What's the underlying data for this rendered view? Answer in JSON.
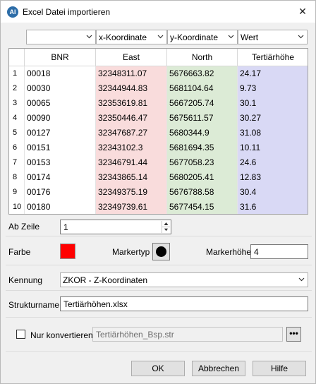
{
  "window": {
    "title": "Excel Datei importieren",
    "close_glyph": "✕",
    "icon_text": "AI"
  },
  "column_mapping": [
    "",
    "x-Koordinate",
    "y-Koordinate",
    "Wert"
  ],
  "table": {
    "headers": [
      "BNR",
      "East",
      "North",
      "Tertiärhöhe"
    ],
    "rows": [
      {
        "n": "1",
        "bnr": "00018",
        "east": "32348311.07",
        "north": "5676663.82",
        "tert": "24.17"
      },
      {
        "n": "2",
        "bnr": "00030",
        "east": "32344944.83",
        "north": "5681104.64",
        "tert": "9.73"
      },
      {
        "n": "3",
        "bnr": "00065",
        "east": "32353619.81",
        "north": "5667205.74",
        "tert": "30.1"
      },
      {
        "n": "4",
        "bnr": "00090",
        "east": "32350446.47",
        "north": "5675611.57",
        "tert": "30.27"
      },
      {
        "n": "5",
        "bnr": "00127",
        "east": "32347687.27",
        "north": "5680344.9",
        "tert": "31.08"
      },
      {
        "n": "6",
        "bnr": "00151",
        "east": "32343102.3",
        "north": "5681694.35",
        "tert": "10.11"
      },
      {
        "n": "7",
        "bnr": "00153",
        "east": "32346791.44",
        "north": "5677058.23",
        "tert": "24.6"
      },
      {
        "n": "8",
        "bnr": "00174",
        "east": "32343865.14",
        "north": "5680205.41",
        "tert": "12.83"
      },
      {
        "n": "9",
        "bnr": "00176",
        "east": "32349375.19",
        "north": "5676788.58",
        "tert": "30.4"
      },
      {
        "n": "10",
        "bnr": "00180",
        "east": "32349739.61",
        "north": "5677454.15",
        "tert": "31.6"
      }
    ]
  },
  "ab_zeile": {
    "label": "Ab Zeile",
    "value": "1"
  },
  "farbe": {
    "label": "Farbe",
    "color": "#ff0000"
  },
  "markertyp": {
    "label": "Markertyp",
    "icon": "filled-circle"
  },
  "markerhoehe": {
    "label": "Markerhöhe",
    "value": "4"
  },
  "kennung": {
    "label": "Kennung",
    "value": "ZKOR - Z-Koordinaten"
  },
  "strukturname": {
    "label": "Strukturname",
    "value": "Tertiärhöhen.xlsx"
  },
  "nur_konvertieren": {
    "label": "Nur konvertieren",
    "checked": false,
    "file": "Tertiärhöhen_Bsp.str",
    "browse_label": "•••"
  },
  "buttons": {
    "ok": "OK",
    "cancel": "Abbrechen",
    "help": "Hilfe"
  }
}
